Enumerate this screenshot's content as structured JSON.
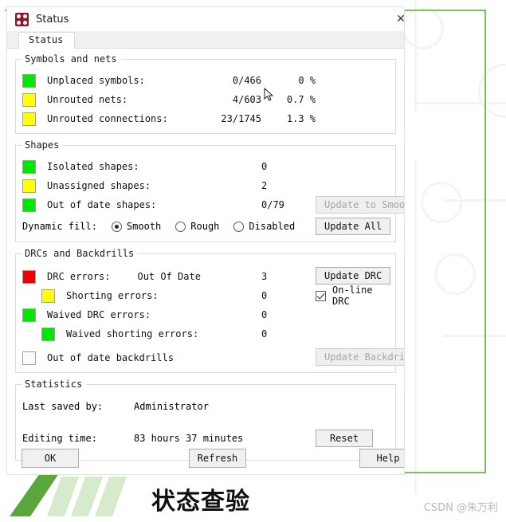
{
  "window": {
    "title": "Status",
    "icon": "status-app-icon",
    "close_label": "✕"
  },
  "tabs": [
    {
      "label": "Status",
      "active": true
    }
  ],
  "groups": {
    "symbols_and_nets": {
      "legend": "Symbols and nets",
      "rows": [
        {
          "swatch": "green",
          "label": "Unplaced symbols:",
          "count": "0/466",
          "percent": "0 %"
        },
        {
          "swatch": "yellow",
          "label": "Unrouted nets:",
          "count": "4/603",
          "percent": "0.7 %"
        },
        {
          "swatch": "yellow",
          "label": "Unrouted connections:",
          "count": "23/1745",
          "percent": "1.3 %"
        }
      ]
    },
    "shapes": {
      "legend": "Shapes",
      "rows": [
        {
          "swatch": "green",
          "label": "Isolated shapes:",
          "value": "0",
          "button": null
        },
        {
          "swatch": "yellow",
          "label": "Unassigned shapes:",
          "value": "2",
          "button": null
        },
        {
          "swatch": "green",
          "label": "Out of date shapes:",
          "value": "0/79",
          "button": "Update to Smooth",
          "button_disabled": true
        }
      ],
      "dynamic_fill": {
        "label": "Dynamic fill:",
        "options": [
          {
            "label": "Smooth",
            "selected": true
          },
          {
            "label": "Rough",
            "selected": false
          },
          {
            "label": "Disabled",
            "selected": false
          }
        ],
        "button": "Update All"
      }
    },
    "drcs_and_backdrills": {
      "legend": "DRCs and Backdrills",
      "rows": [
        {
          "swatch": "red",
          "label": "DRC errors:",
          "state": "Out Of Date",
          "value": "3",
          "sub": false
        },
        {
          "swatch": "yellow",
          "label": "Shorting errors:",
          "state": "",
          "value": "0",
          "sub": true
        },
        {
          "swatch": "green",
          "label": "Waived DRC errors:",
          "state": "",
          "value": "0",
          "sub": false
        },
        {
          "swatch": "green",
          "label": "Waived shorting errors:",
          "state": "",
          "value": "0",
          "sub": true
        },
        {
          "swatch": "none",
          "label": "Out of date backdrills",
          "state": "",
          "value": "",
          "sub": false
        }
      ],
      "update_drc_button": "Update DRC",
      "online_drc": {
        "label": "On-line DRC",
        "checked": true
      },
      "update_backdrill_button": "Update Backdrill",
      "update_backdrill_disabled": true
    },
    "statistics": {
      "legend": "Statistics",
      "rows": [
        {
          "key": "Last saved by:",
          "value": "Administrator"
        },
        {
          "key": "Editing time:",
          "value": "83 hours 37 minutes"
        }
      ],
      "reset_button": "Reset"
    }
  },
  "footer": {
    "ok": "OK",
    "refresh": "Refresh",
    "help": "Help"
  },
  "slide": {
    "title_cn": "状态查验",
    "watermark": "CSDN @朱万利",
    "accent_color": "#79c05a",
    "stripe_color": "#d6ebcb"
  }
}
